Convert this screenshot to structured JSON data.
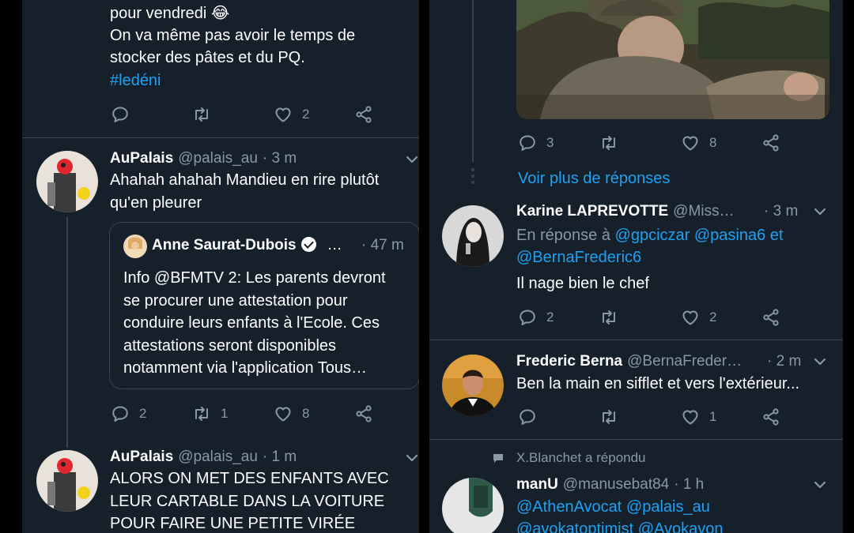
{
  "left": {
    "top_tweet": {
      "lines": [
        "pour vendredi 😂",
        "On va même pas avoir le temps de",
        "stocker des pâtes et du PQ."
      ],
      "hashtag": "#ledéni",
      "like_count": "2"
    },
    "tweet1": {
      "name": "AuPalais",
      "handle": "@palais_au",
      "time": "· 3 m",
      "lines": [
        "Ahahah ahahah Mandieu en rire plutôt",
        "qu'en pleurer"
      ],
      "quote": {
        "name": "Anne Saurat-Dubois",
        "ellipsis": "…",
        "time": "· 47 m",
        "lines": [
          "Info @BFMTV 2: Les parents devront",
          "se procurer une attestation pour",
          "conduire leurs enfants à l'Ecole. Ces",
          "attestations seront disponibles",
          "notamment via l'application Tous…"
        ]
      },
      "reply_count": "2",
      "retweet_count": "1",
      "like_count": "8"
    },
    "tweet2": {
      "name": "AuPalais",
      "handle": "@palais_au",
      "time": "· 1 m",
      "lines": [
        "ALORS ON MET DES ENFANTS AVEC",
        "LEUR CARTABLE DANS LA VOITURE",
        "POUR FAIRE UNE PETITE VIRÉE"
      ]
    }
  },
  "right": {
    "top_tweet": {
      "reply_count": "3",
      "like_count": "8"
    },
    "more_replies": "Voir plus de réponses",
    "karine": {
      "name": "Karine LAPREVOTTE",
      "handle": "@Miss…",
      "time": "· 3 m",
      "in_reply_prefix": "En réponse à",
      "mentions_line1": "@gpciczar @pasina6 et",
      "mentions_line2": "@BernaFrederic6",
      "text": "Il nage bien le chef",
      "reply_count": "2",
      "like_count": "2"
    },
    "frederic": {
      "name": "Frederic Berna",
      "handle": "@BernaFreder…",
      "time": "· 2 m",
      "text": "Ben la main en sifflet et vers l'extérieur...",
      "like_count": "1"
    },
    "replied_notice": "X.Blanchet a répondu",
    "manu": {
      "name": "manU",
      "handle": "@manusebat84",
      "time": "· 1 h",
      "mentions_line1": "@AthenAvocat @palais_au",
      "mentions_line2": "@avokatoptimist @Avokavon"
    }
  },
  "colors": {
    "background": "#15202b",
    "link": "#1da1f2",
    "muted": "#8899a6",
    "divider": "#38444d"
  },
  "icons": [
    "reply-icon",
    "retweet-icon",
    "like-icon",
    "share-icon",
    "chevron-down-icon",
    "verified-icon",
    "comment-bubble-icon"
  ]
}
